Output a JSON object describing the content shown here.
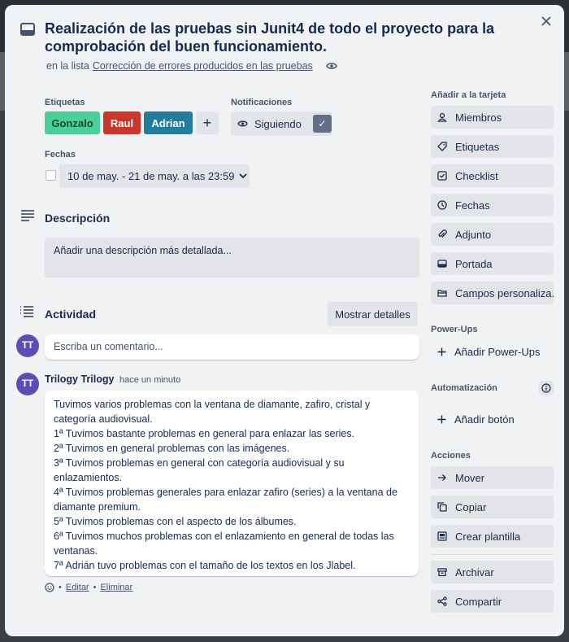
{
  "card": {
    "title": "Realización de las pruebas sin Junit4 de todo el proyecto para la comprobación del buen funcionamiento.",
    "list_prefix": "en la lista",
    "list_name": "Corrección de errores producidos en las pruebas"
  },
  "labels_section": {
    "heading": "Etiquetas",
    "labels": [
      {
        "text": "Gonzalo",
        "color": "#4bce97",
        "text_color": "#164b35"
      },
      {
        "text": "Raul",
        "color": "#c9372c",
        "text_color": "#ffffff"
      },
      {
        "text": "Adrian",
        "color": "#227d9b",
        "text_color": "#ffffff"
      }
    ],
    "add_symbol": "+"
  },
  "notifications": {
    "heading": "Notificaciones",
    "button_label": "Siguiendo",
    "check": "✓"
  },
  "dates": {
    "heading": "Fechas",
    "value": "10 de may. - 21 de may. a las 23:59"
  },
  "description": {
    "heading": "Descripción",
    "placeholder": "Añadir una descripción más detallada..."
  },
  "activity": {
    "heading": "Actividad",
    "toggle_button": "Mostrar detalles",
    "comment_placeholder": "Escriba un comentario...",
    "user_initials": "TT"
  },
  "comment": {
    "author": "Trilogy Trilogy",
    "time": "hace un minuto",
    "initials": "TT",
    "lines": [
      "Tuvimos varios problemas con la ventana de diamante, zafiro, cristal y categoría audiovisual.",
      "1ª Tuvimos bastante problemas en general para enlazar las series.",
      "2ª Tuvimos en general problemas con las imágenes.",
      "3ª Tuvimos problemas en general con categoría audiovisual y su enlazamientos.",
      "4ª Tuvimos problemas generales para enlazar zafiro (series) a la ventana de diamante premium.",
      "5ª Tuvimos problemas con el aspecto de los álbumes.",
      "6ª Tuvimos muchos problemas con el enlazamiento en general de todas las ventanas.",
      "7ª Adrián tuvo problemas con el tamaño de los textos en los Jlabel."
    ],
    "bullet": "•",
    "edit": "Editar",
    "delete": "Eliminar"
  },
  "sidebar": {
    "add_to_card": "Añadir a la tarjeta",
    "add_items": [
      {
        "label": "Miembros",
        "icon": "person-icon"
      },
      {
        "label": "Etiquetas",
        "icon": "tag-icon"
      },
      {
        "label": "Checklist",
        "icon": "checkbox-icon"
      },
      {
        "label": "Fechas",
        "icon": "clock-icon"
      },
      {
        "label": "Adjunto",
        "icon": "paperclip-icon"
      },
      {
        "label": "Portada",
        "icon": "cover-icon"
      },
      {
        "label": "Campos personaliza...",
        "icon": "fields-icon"
      }
    ],
    "powerups_heading": "Power-Ups",
    "add_powerups": "Añadir Power-Ups",
    "automation_heading": "Automatización",
    "add_button": "Añadir botón",
    "actions_heading": "Acciones",
    "actions": [
      {
        "label": "Mover",
        "icon": "arrow-right-icon"
      },
      {
        "label": "Copiar",
        "icon": "copy-icon"
      },
      {
        "label": "Crear plantilla",
        "icon": "template-icon"
      },
      {
        "label": "Archivar",
        "icon": "archive-icon"
      },
      {
        "label": "Compartir",
        "icon": "share-icon"
      }
    ]
  }
}
